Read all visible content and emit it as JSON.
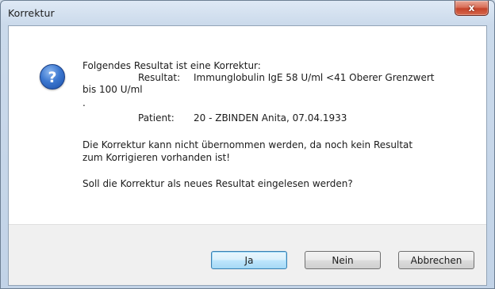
{
  "window": {
    "title": "Korrektur",
    "close_glyph": "x"
  },
  "dialog": {
    "icon": "question-icon",
    "lines": [
      "Folgendes Resultat ist eine Korrektur:",
      "Resultat:",
      "Immunglobulin IgE 58 U/ml <41 Oberer Grenzwert",
      "bis 100 U/ml",
      ".",
      "Patient:",
      "20 - ZBINDEN Anita, 07.04.1933",
      "Die Korrektur kann nicht übernommen werden, da noch kein Resultat",
      "zum Korrigieren vorhanden ist!",
      "Soll die Korrektur als neues Resultat eingelesen werden?"
    ]
  },
  "buttons": {
    "yes": "Ja",
    "no": "Nein",
    "cancel": "Abbrechen"
  },
  "colors": {
    "title_bar": "#cbdaeb",
    "close_button": "#c4432a",
    "icon_blue": "#3c78d0",
    "default_button_border": "#3c7fb1",
    "footer_bg": "#f0f0f0"
  }
}
